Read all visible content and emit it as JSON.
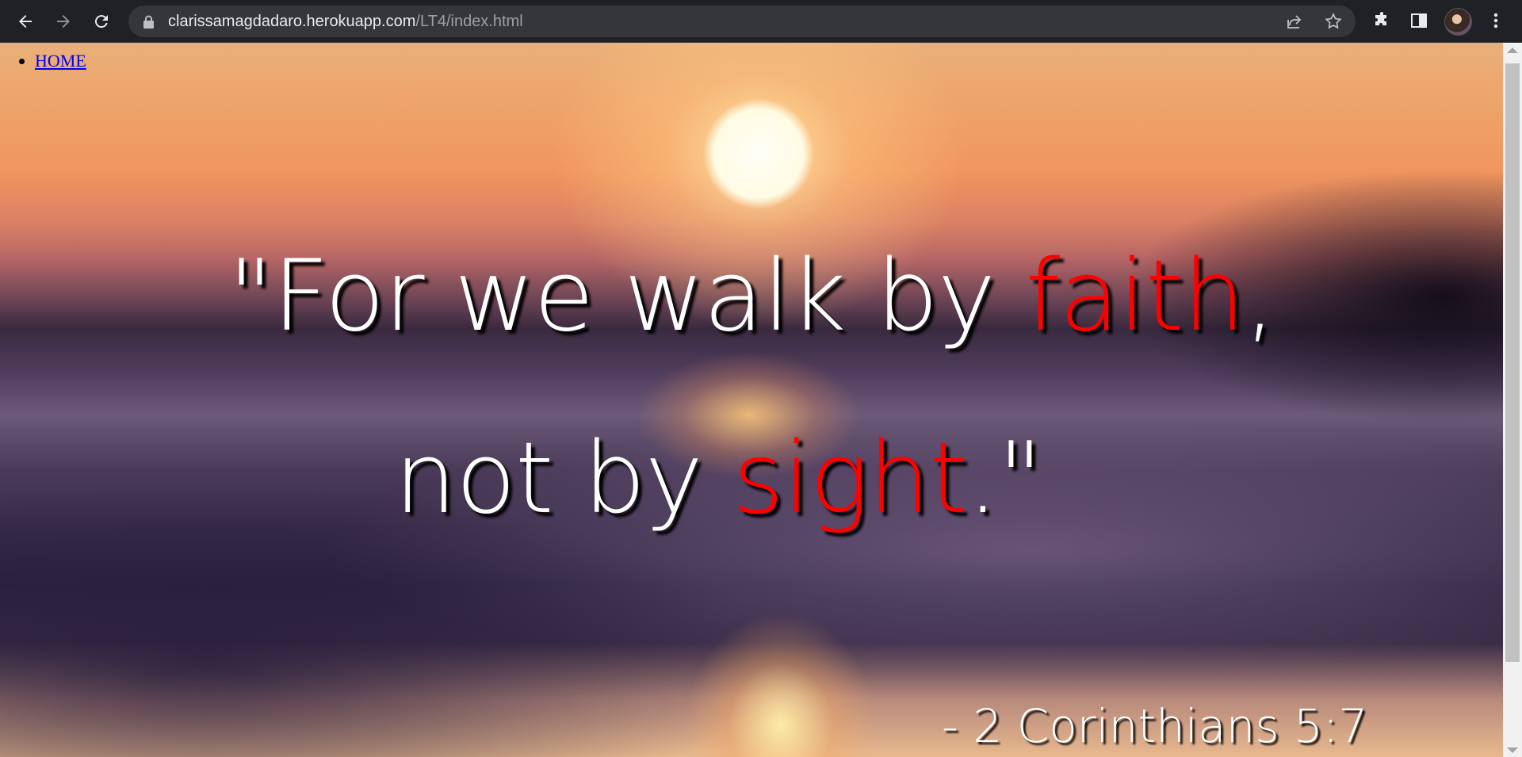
{
  "browser": {
    "url_host": "clarissamagdadaro.herokuapp.com",
    "url_path": "/LT4/index.html",
    "icons": [
      "back-arrow-icon",
      "forward-arrow-icon",
      "reload-icon",
      "lock-icon",
      "share-icon",
      "star-icon",
      "extensions-icon",
      "side-panel-icon",
      "kebab-menu-icon"
    ]
  },
  "page": {
    "nav": {
      "home_label": "HOME"
    },
    "quote": {
      "line1_prefix": "\"For we walk by ",
      "line1_highlight": "faith",
      "line1_suffix": ",",
      "line2_prefix": "not by ",
      "line2_highlight": "sight",
      "line2_suffix": ".\""
    },
    "reference": "- 2 Corinthians 5:7",
    "colors": {
      "highlight": "#ff0000",
      "text": "#ffffff"
    }
  }
}
